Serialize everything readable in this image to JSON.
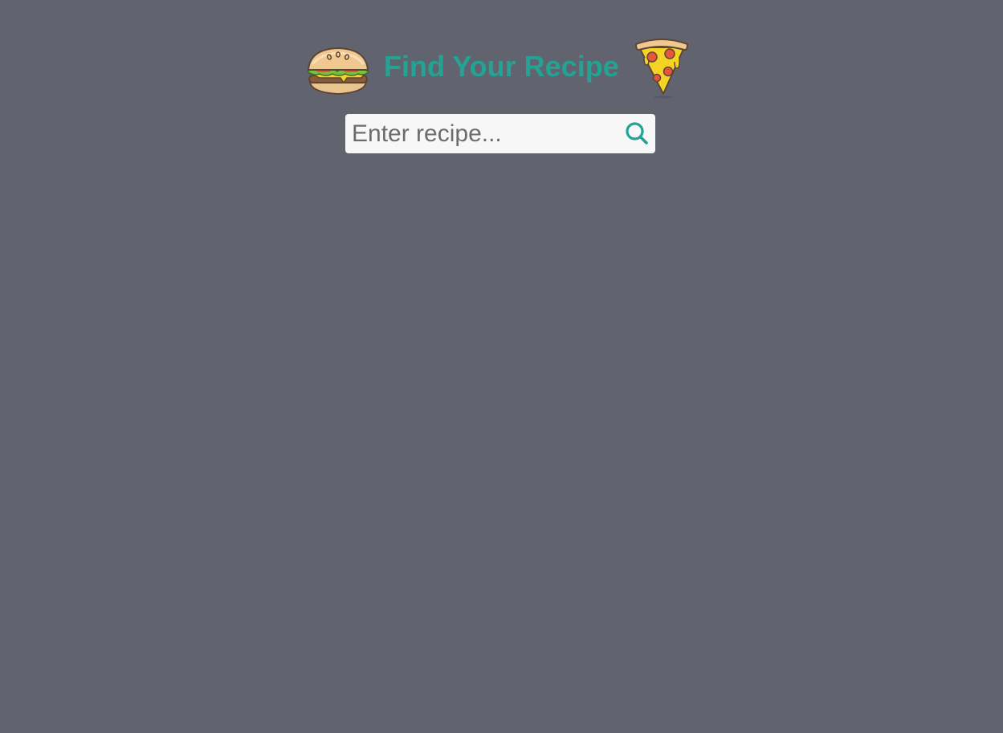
{
  "header": {
    "title": "Find Your Recipe",
    "left_icon": "burger-icon",
    "right_icon": "pizza-icon"
  },
  "search": {
    "placeholder": "Enter recipe...",
    "value": "",
    "button_icon": "search-icon"
  },
  "colors": {
    "background": "#61646f",
    "accent": "#22a393",
    "input_background": "#f7f7f7"
  }
}
